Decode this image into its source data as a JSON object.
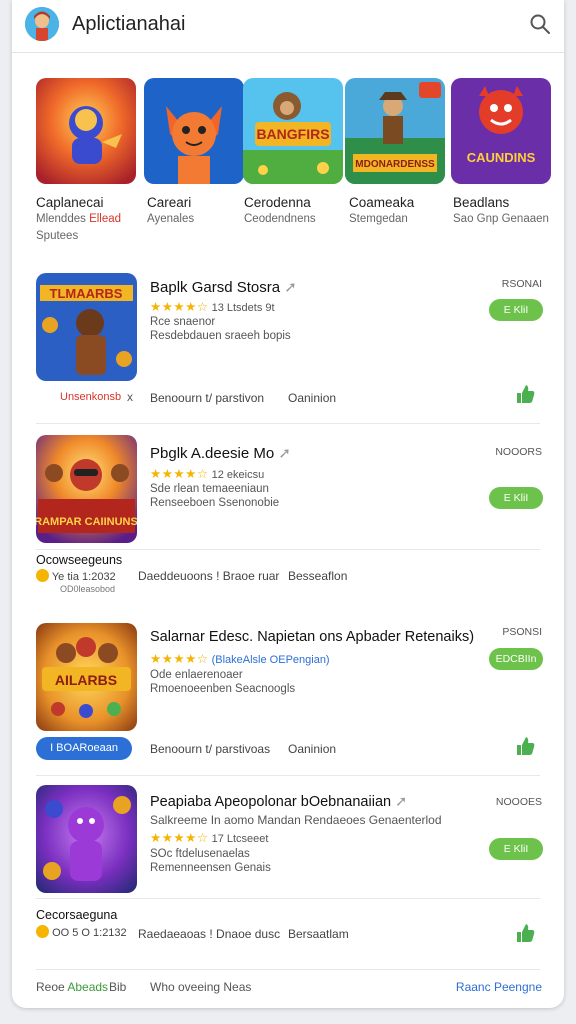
{
  "header": {
    "title": "Aplictianahai",
    "search_icon": "search-icon"
  },
  "featured": [
    {
      "name": "Caplanecai",
      "sub": "Mlenddes",
      "sub_highlight": "Ellead",
      "sub2": "Sputees"
    },
    {
      "name": "Careari",
      "sub": "Ayenales",
      "sub_highlight": "",
      "sub2": ""
    },
    {
      "name": "Cerodenna",
      "sub": "Ceodendnens",
      "sub_highlight": "",
      "sub2": ""
    },
    {
      "name": "Coameaka",
      "sub": "Stemgedan",
      "sub_highlight": "",
      "sub2": ""
    },
    {
      "name": "Beadlans",
      "sub": "Sao Gnp Genaaen",
      "sub_highlight": "",
      "sub2": ""
    }
  ],
  "apps": [
    {
      "name": "Baplk Garsd Stosra",
      "rating_text": "13 Ltsdets 9t",
      "line1": "Rce snaenor",
      "line2": "Resdebdauen sraeeh bopis",
      "size": "RSONAI",
      "install_label": "E KliI",
      "tag": "Unsenkonsb",
      "tag_mark": "x",
      "meta1": "Benoourn t/ parstivon",
      "meta2": "Oaninion",
      "icon_text": "TLMAARBS"
    },
    {
      "name": "Pbglk A.deesie  Mo",
      "rating_text": "12 ekeicsu",
      "line1": "Sde rlean temaeeniaun",
      "line2": "Renseeboen Ssenonobie",
      "size": "NOOORS",
      "install_label": "E KliI",
      "sub_title": "Ocowseegeuns",
      "sub_rating": "Ye tia 1:2032",
      "sub_small": "OD0leasobod",
      "meta1": "Daeddeuoons ! Braoe ruar",
      "meta2": "Besseaflon",
      "icon_text": "RAMPAR CAIINUNS"
    },
    {
      "name": "Salarnar Edesc. Napietan ons Apbader Retenaiks)",
      "rating_text": "(BlakeAlsle OEPengian)",
      "line1": "Ode enlaerenoaer",
      "line2": "Rmoenoeenben Seacnoogls",
      "size": "PSONSI",
      "install_label": "EDCBIIn",
      "blue_button": "I BOARoeaan",
      "meta1": "Benoourn t/ parstivoas",
      "meta2": "Oaninion",
      "icon_text": "AILARBS"
    },
    {
      "name": "Peapiaba Apeopolonar bOebnanaiian",
      "rating_text": "17 Ltcseeet",
      "line0": "Salkreeme In aomo Mandan  Rendaeoes Genaenterlod",
      "line1": "SOc ftdelusenaelas",
      "line2": "Remenneensen Genais",
      "size": "NOOOES",
      "install_label": "E KliI",
      "sub_title": "Cecorsaeguna",
      "sub_rating": "OO 5 O 1:2132",
      "sub_small": "",
      "meta1": "Raedaeaoas ! Dnaoe dusc",
      "meta2": "Bersaatlam",
      "icon_text": ""
    }
  ],
  "footer": {
    "left1": "Reoe",
    "left1_green": "Abeads",
    "left2": "Bib",
    "middle": "Who oveeing Neas",
    "right": "Raanc Peengne"
  },
  "colors": {
    "green": "#6cc24a",
    "blue": "#2c6fd6",
    "star": "#f4b400"
  }
}
